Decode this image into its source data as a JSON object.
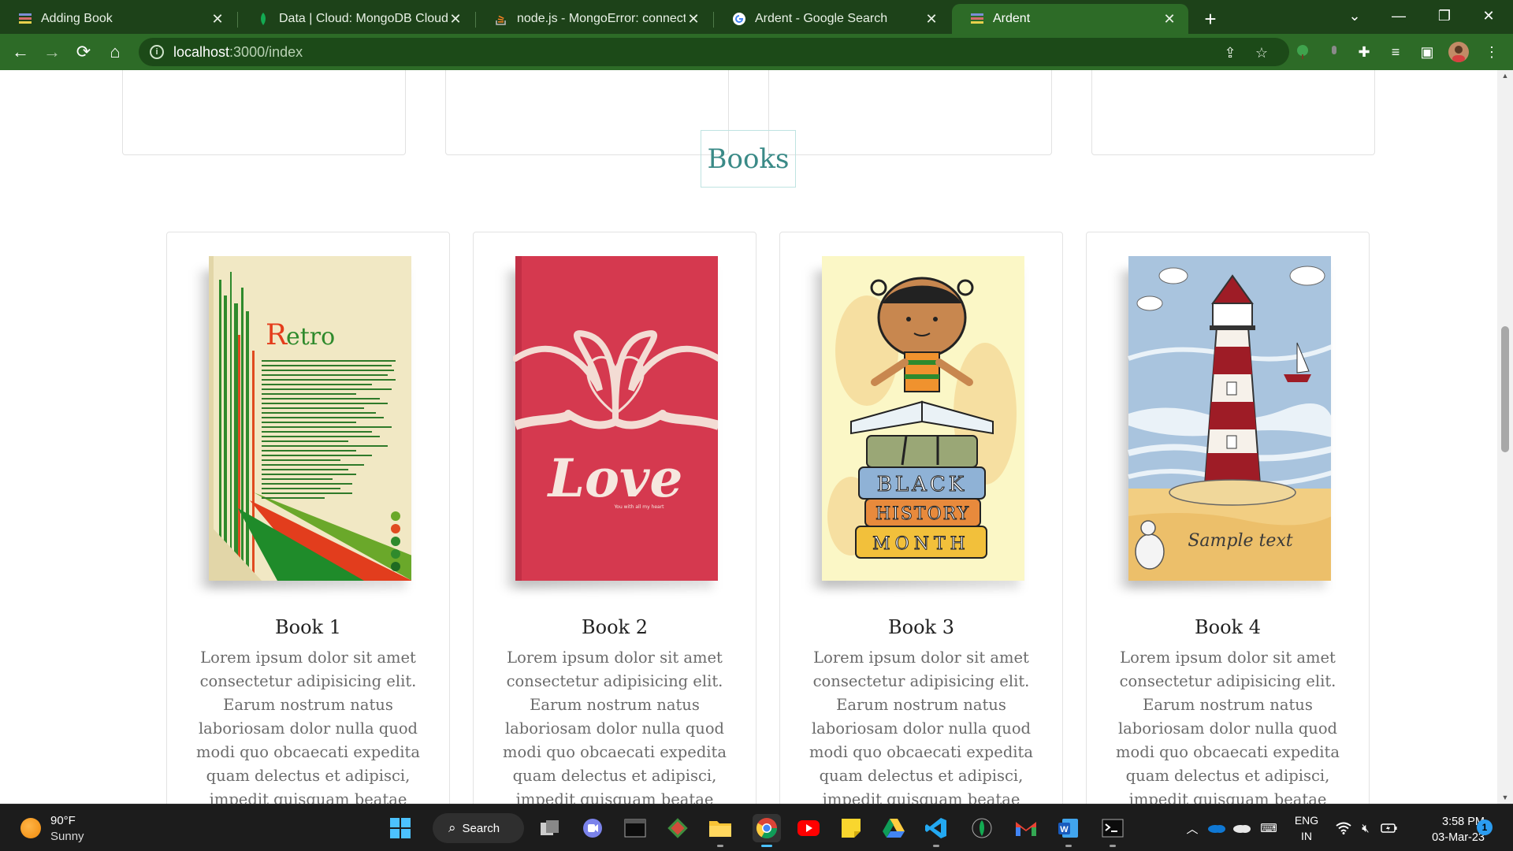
{
  "browser": {
    "tabs": [
      {
        "title": "Adding Book",
        "favicon": "books-icon",
        "active": false
      },
      {
        "title": "Data | Cloud: MongoDB Cloud",
        "favicon": "mongodb-leaf-icon",
        "active": false
      },
      {
        "title": "node.js - MongoError: connect EC",
        "favicon": "stackoverflow-icon",
        "active": false
      },
      {
        "title": "Ardent - Google Search",
        "favicon": "google-icon",
        "active": false
      },
      {
        "title": "Ardent",
        "favicon": "books-icon",
        "active": true
      }
    ],
    "url_host": "localhost",
    "url_path": ":3000/index",
    "theme_color": "#2d6b27"
  },
  "page": {
    "section_title": "Books",
    "accent_color": "#3a8a87",
    "books": [
      {
        "name": "Book 1",
        "cover": "retro-cover",
        "cover_text": "Retro",
        "description": "Lorem ipsum dolor sit amet consectetur adipisicing elit. Earum nostrum natus laboriosam dolor nulla quod modi quo obcaecati expedita quam delectus et adipisci, impedit quisquam beatae dolore!"
      },
      {
        "name": "Book 2",
        "cover": "love-cover",
        "cover_text": "Love",
        "description": "Lorem ipsum dolor sit amet consectetur adipisicing elit. Earum nostrum natus laboriosam dolor nulla quod modi quo obcaecati expedita quam delectus et adipisci, impedit quisquam beatae dolore!"
      },
      {
        "name": "Book 3",
        "cover": "black-history-month-cover",
        "cover_text": [
          "BLACK",
          "HISTORY",
          "MONTH"
        ],
        "description": "Lorem ipsum dolor sit amet consectetur adipisicing elit. Earum nostrum natus laboriosam dolor nulla quod modi quo obcaecati expedita quam delectus et adipisci, impedit quisquam beatae dolore!"
      },
      {
        "name": "Book 4",
        "cover": "lighthouse-cover",
        "cover_text": "Sample text",
        "description": "Lorem ipsum dolor sit amet consectetur adipisicing elit. Earum nostrum natus laboriosam dolor nulla quod modi quo obcaecati expedita quam delectus et adipisci, impedit quisquam beatae dolore!"
      }
    ]
  },
  "taskbar": {
    "weather_temp": "90°F",
    "weather_condition": "Sunny",
    "search_label": "Search",
    "language": "ENG",
    "region": "IN",
    "time": "3:58 PM",
    "date": "03-Mar-23",
    "notification_count": "1"
  }
}
